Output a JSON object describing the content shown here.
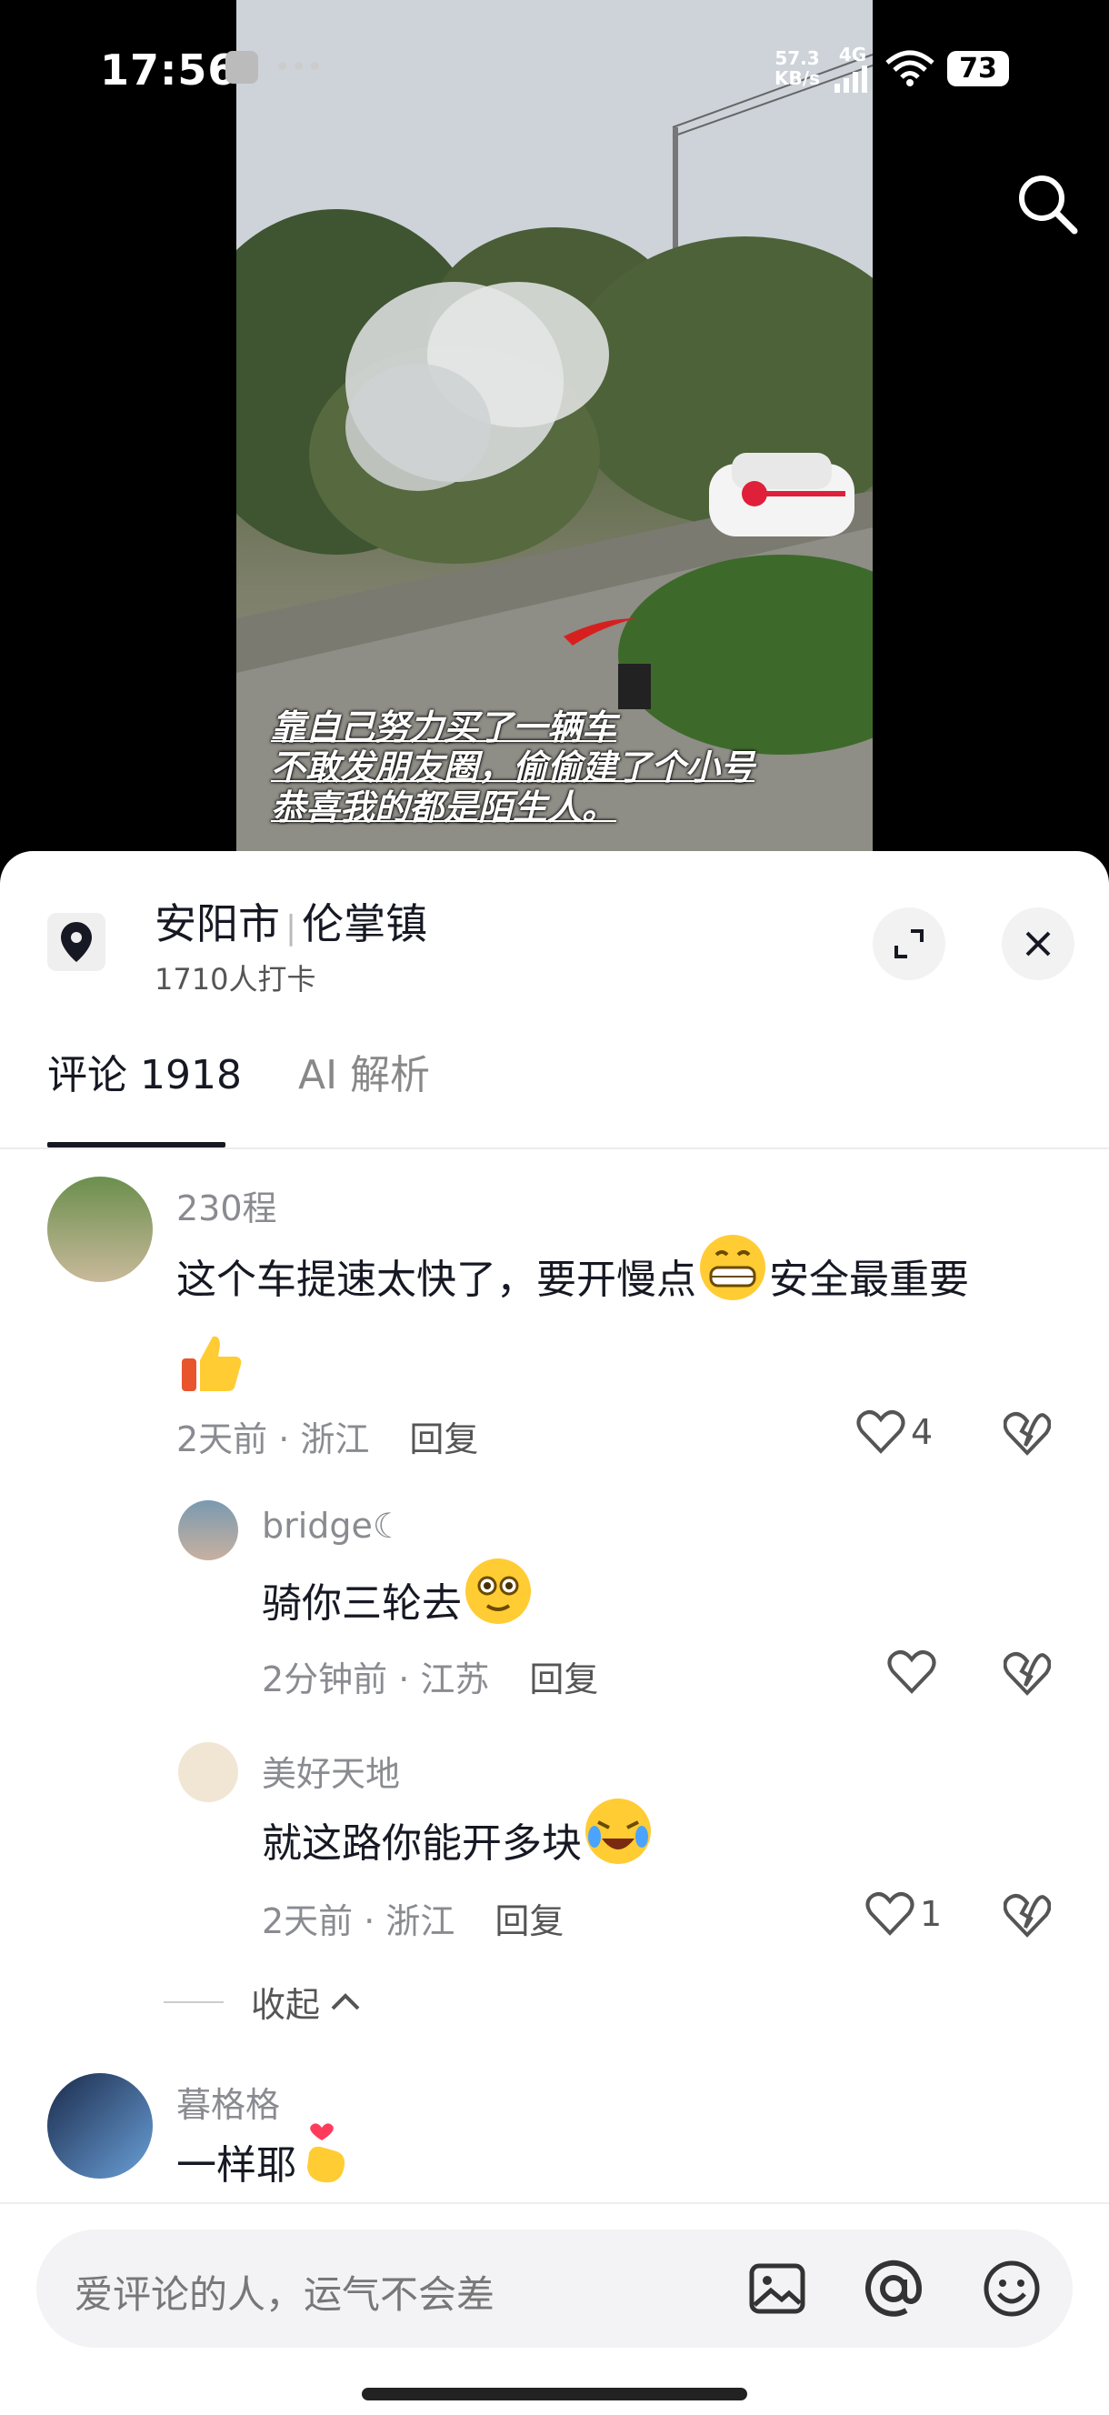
{
  "status_bar": {
    "time": "17:56",
    "net_speed_value": "57.3",
    "net_speed_unit": "KB/s",
    "network": "4G",
    "battery": "73"
  },
  "video": {
    "subtitle_lines": [
      "靠自己努力买了一辆车",
      "不敢发朋友圈，偷偷建了个小号",
      "恭喜我的都是陌生人。"
    ]
  },
  "location": {
    "city": "安阳市",
    "town": "伦掌镇",
    "checkins": "1710人打卡"
  },
  "tabs": {
    "comments": "评论 1918",
    "ai": "AI 解析"
  },
  "comments": [
    {
      "user": "230程",
      "text": "这个车提速太快了，要开慢点",
      "text2": "安全最重要",
      "time": "2天前 · 浙江",
      "reply": "回复",
      "likes": "4"
    },
    {
      "user": "bridge☾",
      "text": "骑你三轮去",
      "time": "2分钟前 · 江苏",
      "reply": "回复",
      "likes": ""
    },
    {
      "user": "美好天地",
      "text": "就这路你能开多块",
      "time": "2天前 · 浙江",
      "reply": "回复",
      "likes": "1"
    },
    {
      "user": "暮格格",
      "text": "一样耶"
    }
  ],
  "collapse_label": "收起",
  "input": {
    "placeholder": "爱评论的人，运气不会差"
  },
  "colors": {
    "accent_red": "#ff2d55",
    "text_dark": "#161823",
    "text_grey": "#8a8b91"
  }
}
